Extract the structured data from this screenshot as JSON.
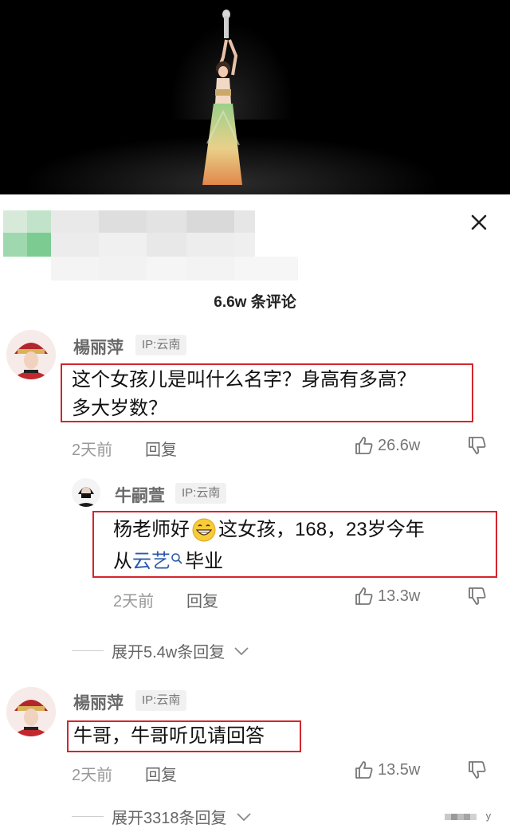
{
  "video": {
    "scene": "dancer-on-stage"
  },
  "sheet": {
    "comment_count_label": "6.6w 条评论",
    "close_icon": "close-icon"
  },
  "comments": [
    {
      "username": "楊丽萍",
      "ip": "IP:云南",
      "text_line1": "这个女孩儿是叫什么名字？身高有多高？",
      "text_line2": "多大岁数？",
      "time": "2天前",
      "reply_label": "回复",
      "likes": "26.6w",
      "replies": [
        {
          "username": "牛嗣萱",
          "ip": "IP:云南",
          "text_line1_a": "杨老师好",
          "text_line1_b": "这女孩，168，23岁今年",
          "text_line2_a": "从",
          "text_line2_link": "云艺",
          "text_line2_b": "毕业",
          "time": "2天前",
          "reply_label": "回复",
          "likes": "13.3w"
        }
      ],
      "expand_label": "展开5.4w条回复"
    },
    {
      "username": "楊丽萍",
      "ip": "IP:云南",
      "text": "牛哥，牛哥听见请回答",
      "time": "2天前",
      "reply_label": "回复",
      "likes": "13.5w",
      "expand_label": "展开3318条回复"
    }
  ],
  "watermark": "y",
  "colors": {
    "highlight_box": "#d2262d",
    "link": "#2b5aa8"
  }
}
